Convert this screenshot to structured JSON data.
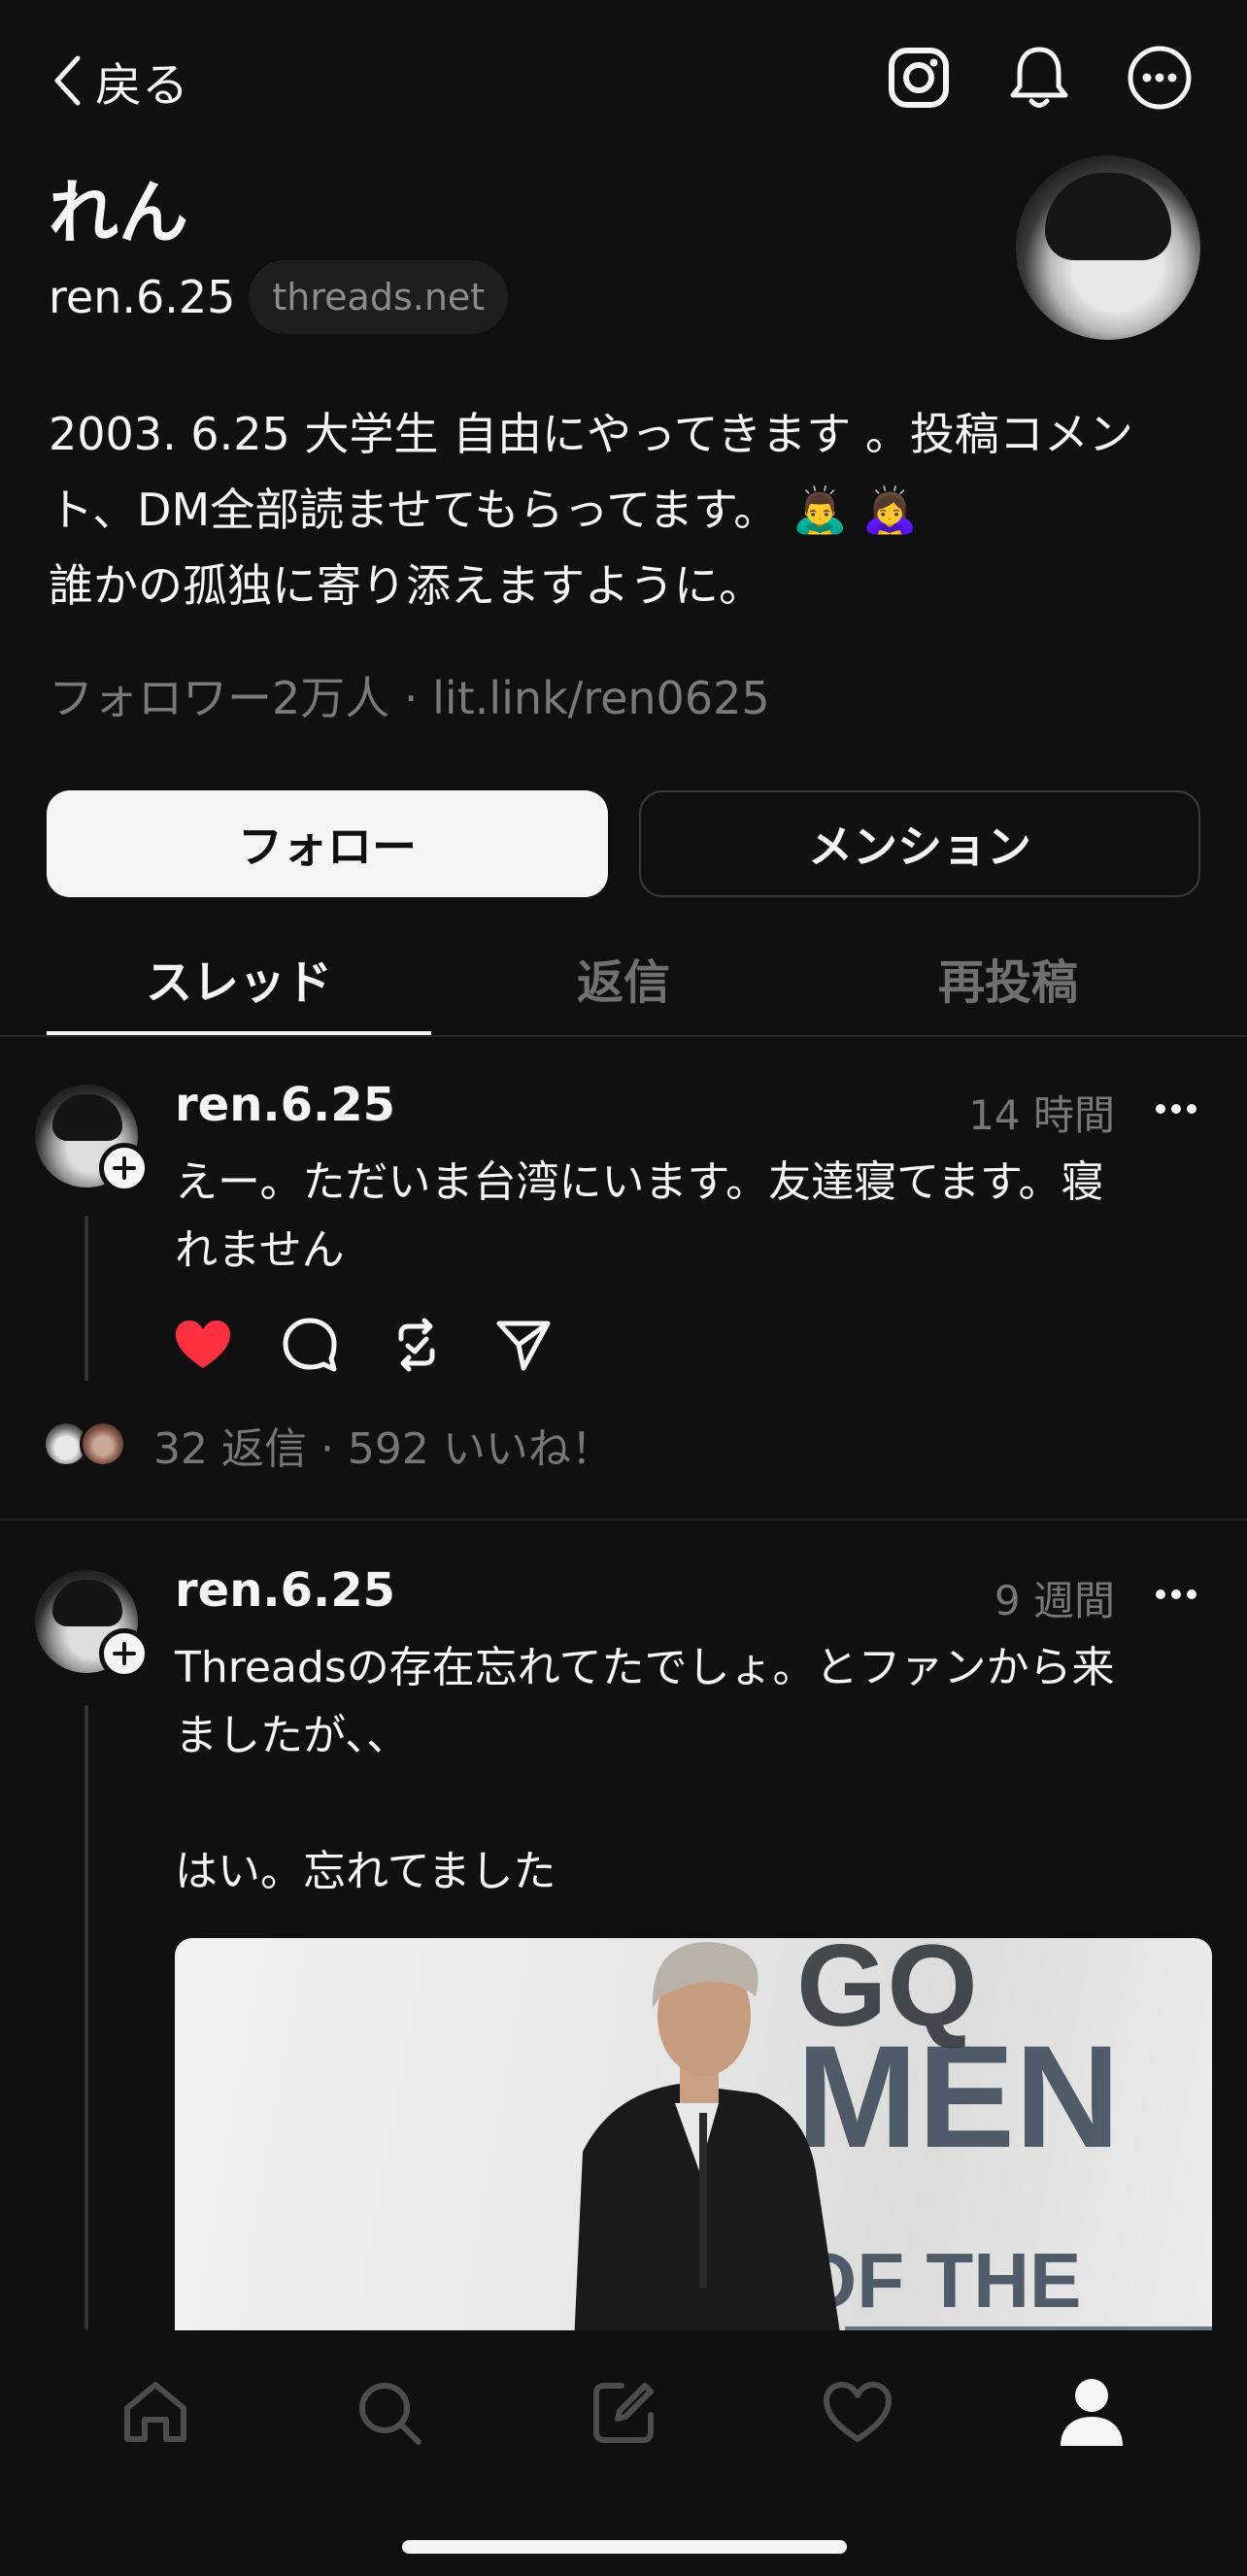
{
  "header": {
    "back_label": "戻る",
    "icons": [
      "instagram-icon",
      "bell-icon",
      "more-circle-icon"
    ]
  },
  "profile": {
    "name": "れん",
    "handle": "ren.6.25",
    "domain_badge": "threads.net",
    "bio_lines": [
      "2003. 6.25 大学生 自由にやってきます 。投稿コメン",
      "ト、DM全部読ませてもらってます。 🙇‍♂️ 🙇‍♀️",
      "誰かの孤独に寄り添えますように。"
    ],
    "meta": "フォロワー2万人 · lit.link/ren0625"
  },
  "buttons": {
    "follow": "フォロー",
    "mention": "メンション"
  },
  "tabs": [
    {
      "label": "スレッド",
      "active": true
    },
    {
      "label": "返信",
      "active": false
    },
    {
      "label": "再投稿",
      "active": false
    }
  ],
  "posts": [
    {
      "username": "ren.6.25",
      "time": "14 時間",
      "text_lines": [
        "えー。ただいま台湾にいます。友達寝てます。寝",
        "れません"
      ],
      "liked": true,
      "stats": "32 返信 · 592 いいね！"
    },
    {
      "username": "ren.6.25",
      "time": "9 週間",
      "text_lines": [
        "Threadsの存在忘れてたでしょ。とファンから来",
        "ましたが、、",
        "",
        "はい。忘れてました"
      ],
      "image_text": [
        "GQ",
        "MEN",
        "OF THE"
      ]
    }
  ],
  "nav": [
    "home-icon",
    "search-icon",
    "compose-icon",
    "heart-icon",
    "profile-icon"
  ],
  "colors": {
    "background": "#101010",
    "like": "#ff3040",
    "text": "#f3f5f7",
    "muted": "#777777"
  }
}
